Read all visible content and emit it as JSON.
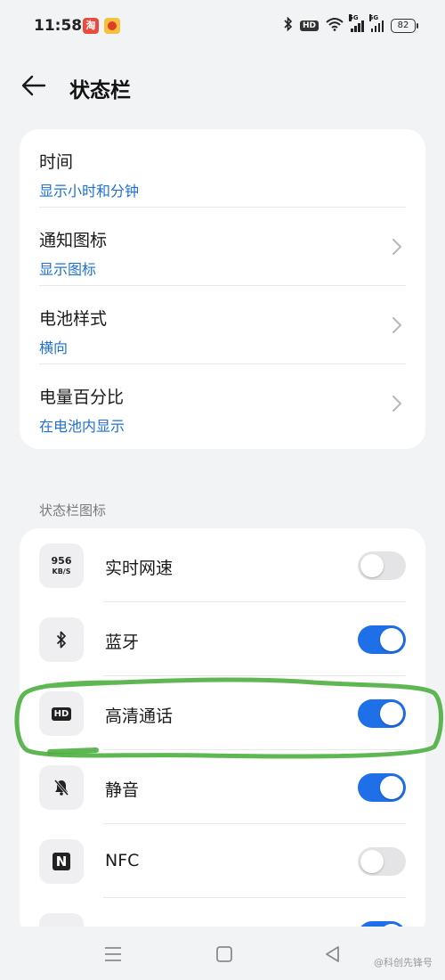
{
  "status_bar": {
    "time": "11:58",
    "app1_glyph": "淘",
    "hd_label": "HD",
    "network_label": "5G",
    "battery": "82"
  },
  "header": {
    "title": "状态栏"
  },
  "settings": [
    {
      "title": "时间",
      "subtitle": "显示小时和分钟"
    },
    {
      "title": "通知图标",
      "subtitle": "显示图标"
    },
    {
      "title": "电池样式",
      "subtitle": "横向"
    },
    {
      "title": "电量百分比",
      "subtitle": "在电池内显示"
    }
  ],
  "section_label": "状态栏图标",
  "icon_items": [
    {
      "label": "实时网速",
      "icon": "network-speed-icon",
      "icon_text": "956",
      "icon_sub": "KB/S",
      "enabled": false
    },
    {
      "label": "蓝牙",
      "icon": "bluetooth-icon",
      "enabled": true
    },
    {
      "label": "高清通话",
      "icon": "hd-call-icon",
      "icon_text": "HD",
      "enabled": true
    },
    {
      "label": "静音",
      "icon": "mute-bell-icon",
      "enabled": true
    },
    {
      "label": "NFC",
      "icon": "nfc-icon",
      "icon_text": "N",
      "enabled": false
    }
  ],
  "colors": {
    "accent": "#1e6fe8",
    "link": "#1d6fd9",
    "highlight": "#4caf3f"
  },
  "watermark": "@科创先锋号"
}
